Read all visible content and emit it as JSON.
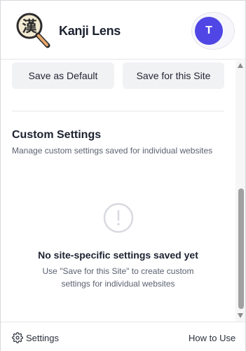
{
  "header": {
    "app_title": "Kanji Lens",
    "logo_glyph": "漢",
    "avatar_initial": "T",
    "avatar_color": "#4f46e5"
  },
  "actions": {
    "save_default_label": "Save as Default",
    "save_site_label": "Save for this Site"
  },
  "custom_settings": {
    "title": "Custom Settings",
    "description": "Manage custom settings saved for individual websites",
    "empty_title": "No site-specific settings saved yet",
    "empty_description": "Use \"Save for this Site\" to create custom settings for individual websites",
    "empty_icon": "alert-circle-icon"
  },
  "footer": {
    "settings_label": "Settings",
    "how_to_label": "How to Use"
  }
}
